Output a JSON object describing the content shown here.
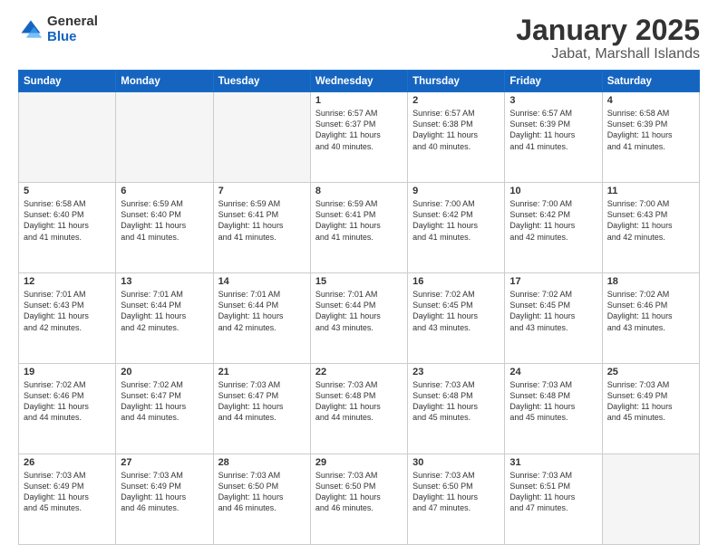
{
  "logo": {
    "general": "General",
    "blue": "Blue"
  },
  "title": "January 2025",
  "subtitle": "Jabat, Marshall Islands",
  "weekdays": [
    "Sunday",
    "Monday",
    "Tuesday",
    "Wednesday",
    "Thursday",
    "Friday",
    "Saturday"
  ],
  "weeks": [
    [
      {
        "day": "",
        "info": ""
      },
      {
        "day": "",
        "info": ""
      },
      {
        "day": "",
        "info": ""
      },
      {
        "day": "1",
        "info": "Sunrise: 6:57 AM\nSunset: 6:37 PM\nDaylight: 11 hours\nand 40 minutes."
      },
      {
        "day": "2",
        "info": "Sunrise: 6:57 AM\nSunset: 6:38 PM\nDaylight: 11 hours\nand 40 minutes."
      },
      {
        "day": "3",
        "info": "Sunrise: 6:57 AM\nSunset: 6:39 PM\nDaylight: 11 hours\nand 41 minutes."
      },
      {
        "day": "4",
        "info": "Sunrise: 6:58 AM\nSunset: 6:39 PM\nDaylight: 11 hours\nand 41 minutes."
      }
    ],
    [
      {
        "day": "5",
        "info": "Sunrise: 6:58 AM\nSunset: 6:40 PM\nDaylight: 11 hours\nand 41 minutes."
      },
      {
        "day": "6",
        "info": "Sunrise: 6:59 AM\nSunset: 6:40 PM\nDaylight: 11 hours\nand 41 minutes."
      },
      {
        "day": "7",
        "info": "Sunrise: 6:59 AM\nSunset: 6:41 PM\nDaylight: 11 hours\nand 41 minutes."
      },
      {
        "day": "8",
        "info": "Sunrise: 6:59 AM\nSunset: 6:41 PM\nDaylight: 11 hours\nand 41 minutes."
      },
      {
        "day": "9",
        "info": "Sunrise: 7:00 AM\nSunset: 6:42 PM\nDaylight: 11 hours\nand 41 minutes."
      },
      {
        "day": "10",
        "info": "Sunrise: 7:00 AM\nSunset: 6:42 PM\nDaylight: 11 hours\nand 42 minutes."
      },
      {
        "day": "11",
        "info": "Sunrise: 7:00 AM\nSunset: 6:43 PM\nDaylight: 11 hours\nand 42 minutes."
      }
    ],
    [
      {
        "day": "12",
        "info": "Sunrise: 7:01 AM\nSunset: 6:43 PM\nDaylight: 11 hours\nand 42 minutes."
      },
      {
        "day": "13",
        "info": "Sunrise: 7:01 AM\nSunset: 6:44 PM\nDaylight: 11 hours\nand 42 minutes."
      },
      {
        "day": "14",
        "info": "Sunrise: 7:01 AM\nSunset: 6:44 PM\nDaylight: 11 hours\nand 42 minutes."
      },
      {
        "day": "15",
        "info": "Sunrise: 7:01 AM\nSunset: 6:44 PM\nDaylight: 11 hours\nand 43 minutes."
      },
      {
        "day": "16",
        "info": "Sunrise: 7:02 AM\nSunset: 6:45 PM\nDaylight: 11 hours\nand 43 minutes."
      },
      {
        "day": "17",
        "info": "Sunrise: 7:02 AM\nSunset: 6:45 PM\nDaylight: 11 hours\nand 43 minutes."
      },
      {
        "day": "18",
        "info": "Sunrise: 7:02 AM\nSunset: 6:46 PM\nDaylight: 11 hours\nand 43 minutes."
      }
    ],
    [
      {
        "day": "19",
        "info": "Sunrise: 7:02 AM\nSunset: 6:46 PM\nDaylight: 11 hours\nand 44 minutes."
      },
      {
        "day": "20",
        "info": "Sunrise: 7:02 AM\nSunset: 6:47 PM\nDaylight: 11 hours\nand 44 minutes."
      },
      {
        "day": "21",
        "info": "Sunrise: 7:03 AM\nSunset: 6:47 PM\nDaylight: 11 hours\nand 44 minutes."
      },
      {
        "day": "22",
        "info": "Sunrise: 7:03 AM\nSunset: 6:48 PM\nDaylight: 11 hours\nand 44 minutes."
      },
      {
        "day": "23",
        "info": "Sunrise: 7:03 AM\nSunset: 6:48 PM\nDaylight: 11 hours\nand 45 minutes."
      },
      {
        "day": "24",
        "info": "Sunrise: 7:03 AM\nSunset: 6:48 PM\nDaylight: 11 hours\nand 45 minutes."
      },
      {
        "day": "25",
        "info": "Sunrise: 7:03 AM\nSunset: 6:49 PM\nDaylight: 11 hours\nand 45 minutes."
      }
    ],
    [
      {
        "day": "26",
        "info": "Sunrise: 7:03 AM\nSunset: 6:49 PM\nDaylight: 11 hours\nand 45 minutes."
      },
      {
        "day": "27",
        "info": "Sunrise: 7:03 AM\nSunset: 6:49 PM\nDaylight: 11 hours\nand 46 minutes."
      },
      {
        "day": "28",
        "info": "Sunrise: 7:03 AM\nSunset: 6:50 PM\nDaylight: 11 hours\nand 46 minutes."
      },
      {
        "day": "29",
        "info": "Sunrise: 7:03 AM\nSunset: 6:50 PM\nDaylight: 11 hours\nand 46 minutes."
      },
      {
        "day": "30",
        "info": "Sunrise: 7:03 AM\nSunset: 6:50 PM\nDaylight: 11 hours\nand 47 minutes."
      },
      {
        "day": "31",
        "info": "Sunrise: 7:03 AM\nSunset: 6:51 PM\nDaylight: 11 hours\nand 47 minutes."
      },
      {
        "day": "",
        "info": ""
      }
    ]
  ]
}
